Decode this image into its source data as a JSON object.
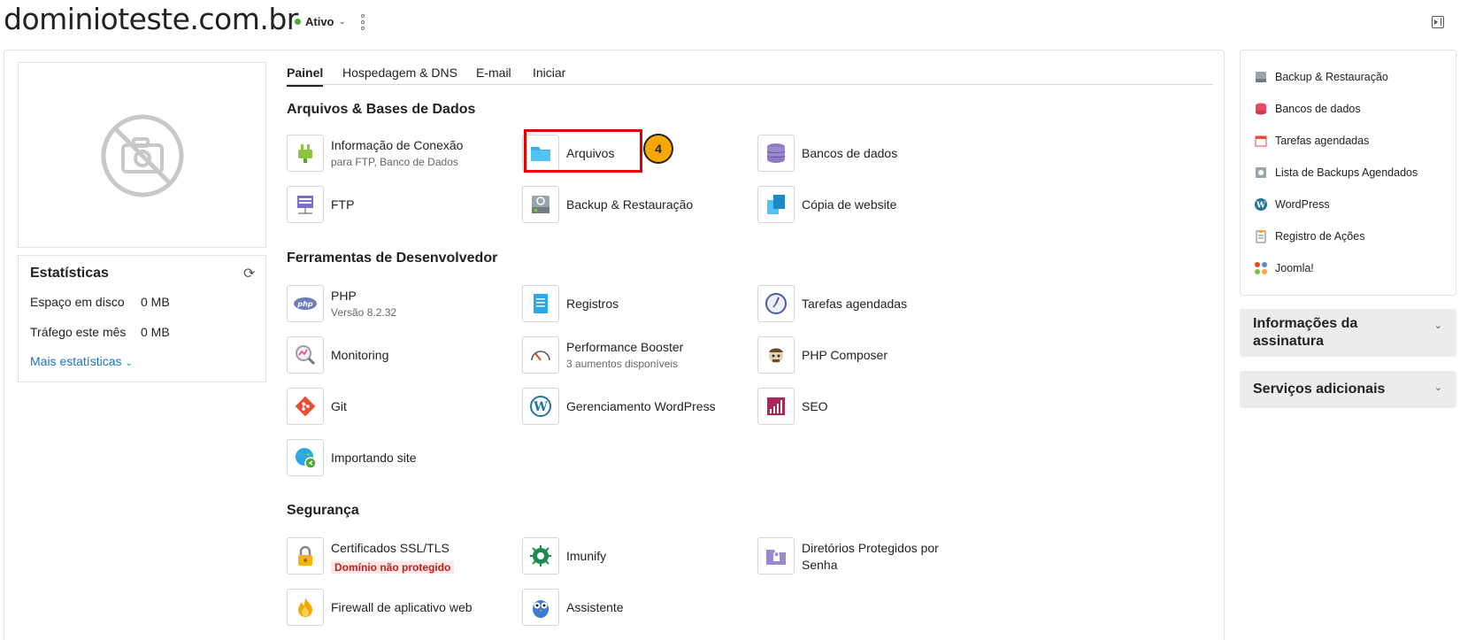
{
  "header": {
    "domain": "dominioteste.com.br",
    "status": "Ativo"
  },
  "stats": {
    "title": "Estatísticas",
    "rows": [
      {
        "label": "Espaço em disco",
        "value": "0 MB"
      },
      {
        "label": "Tráfego este mês",
        "value": "0 MB"
      }
    ],
    "more": "Mais estatísticas"
  },
  "tabs": [
    "Painel",
    "Hospedagem & DNS",
    "E-mail",
    "Iniciar"
  ],
  "sections": {
    "files": "Arquivos & Bases de Dados",
    "dev": "Ferramentas de Desenvolvedor",
    "security": "Segurança"
  },
  "tools": {
    "conexao": {
      "label": "Informação de Conexão",
      "sub": "para FTP, Banco de Dados"
    },
    "arquivos": {
      "label": "Arquivos"
    },
    "bancos": {
      "label": "Bancos de dados"
    },
    "ftp": {
      "label": "FTP"
    },
    "backup": {
      "label": "Backup & Restauração"
    },
    "copia": {
      "label": "Cópia de website"
    },
    "php": {
      "label": "PHP",
      "sub": "Versão 8.2.32"
    },
    "registros": {
      "label": "Registros"
    },
    "tarefas": {
      "label": "Tarefas agendadas"
    },
    "monitoring": {
      "label": "Monitoring"
    },
    "booster": {
      "label": "Performance Booster",
      "sub": "3 aumentos disponíveis"
    },
    "composer": {
      "label": "PHP Composer"
    },
    "git": {
      "label": "Git"
    },
    "wordpress": {
      "label": "Gerenciamento WordPress"
    },
    "seo": {
      "label": "SEO"
    },
    "importando": {
      "label": "Importando site"
    },
    "ssl": {
      "label": "Certificados SSL/TLS",
      "sub": "Domínio não protegido"
    },
    "imunify": {
      "label": "Imunify"
    },
    "diretorios": {
      "label": "Diretórios Protegidos por Senha"
    },
    "firewall": {
      "label": "Firewall de aplicativo web"
    },
    "assistente": {
      "label": "Assistente"
    }
  },
  "annotation": {
    "step": "4"
  },
  "sidebar": {
    "items": [
      "Backup & Restauração",
      "Bancos de dados",
      "Tarefas agendadas",
      "Lista de Backups Agendados",
      "WordPress",
      "Registro de Ações",
      "Joomla!"
    ],
    "sections": [
      "Informações da assinatura",
      "Serviços adicionais"
    ]
  },
  "colors": {
    "status_green": "#4caa2c",
    "highlight_red": "#e00000",
    "badge_orange": "#f6a800",
    "link_blue": "#1a73c9",
    "warning_red": "#c81a1a"
  }
}
